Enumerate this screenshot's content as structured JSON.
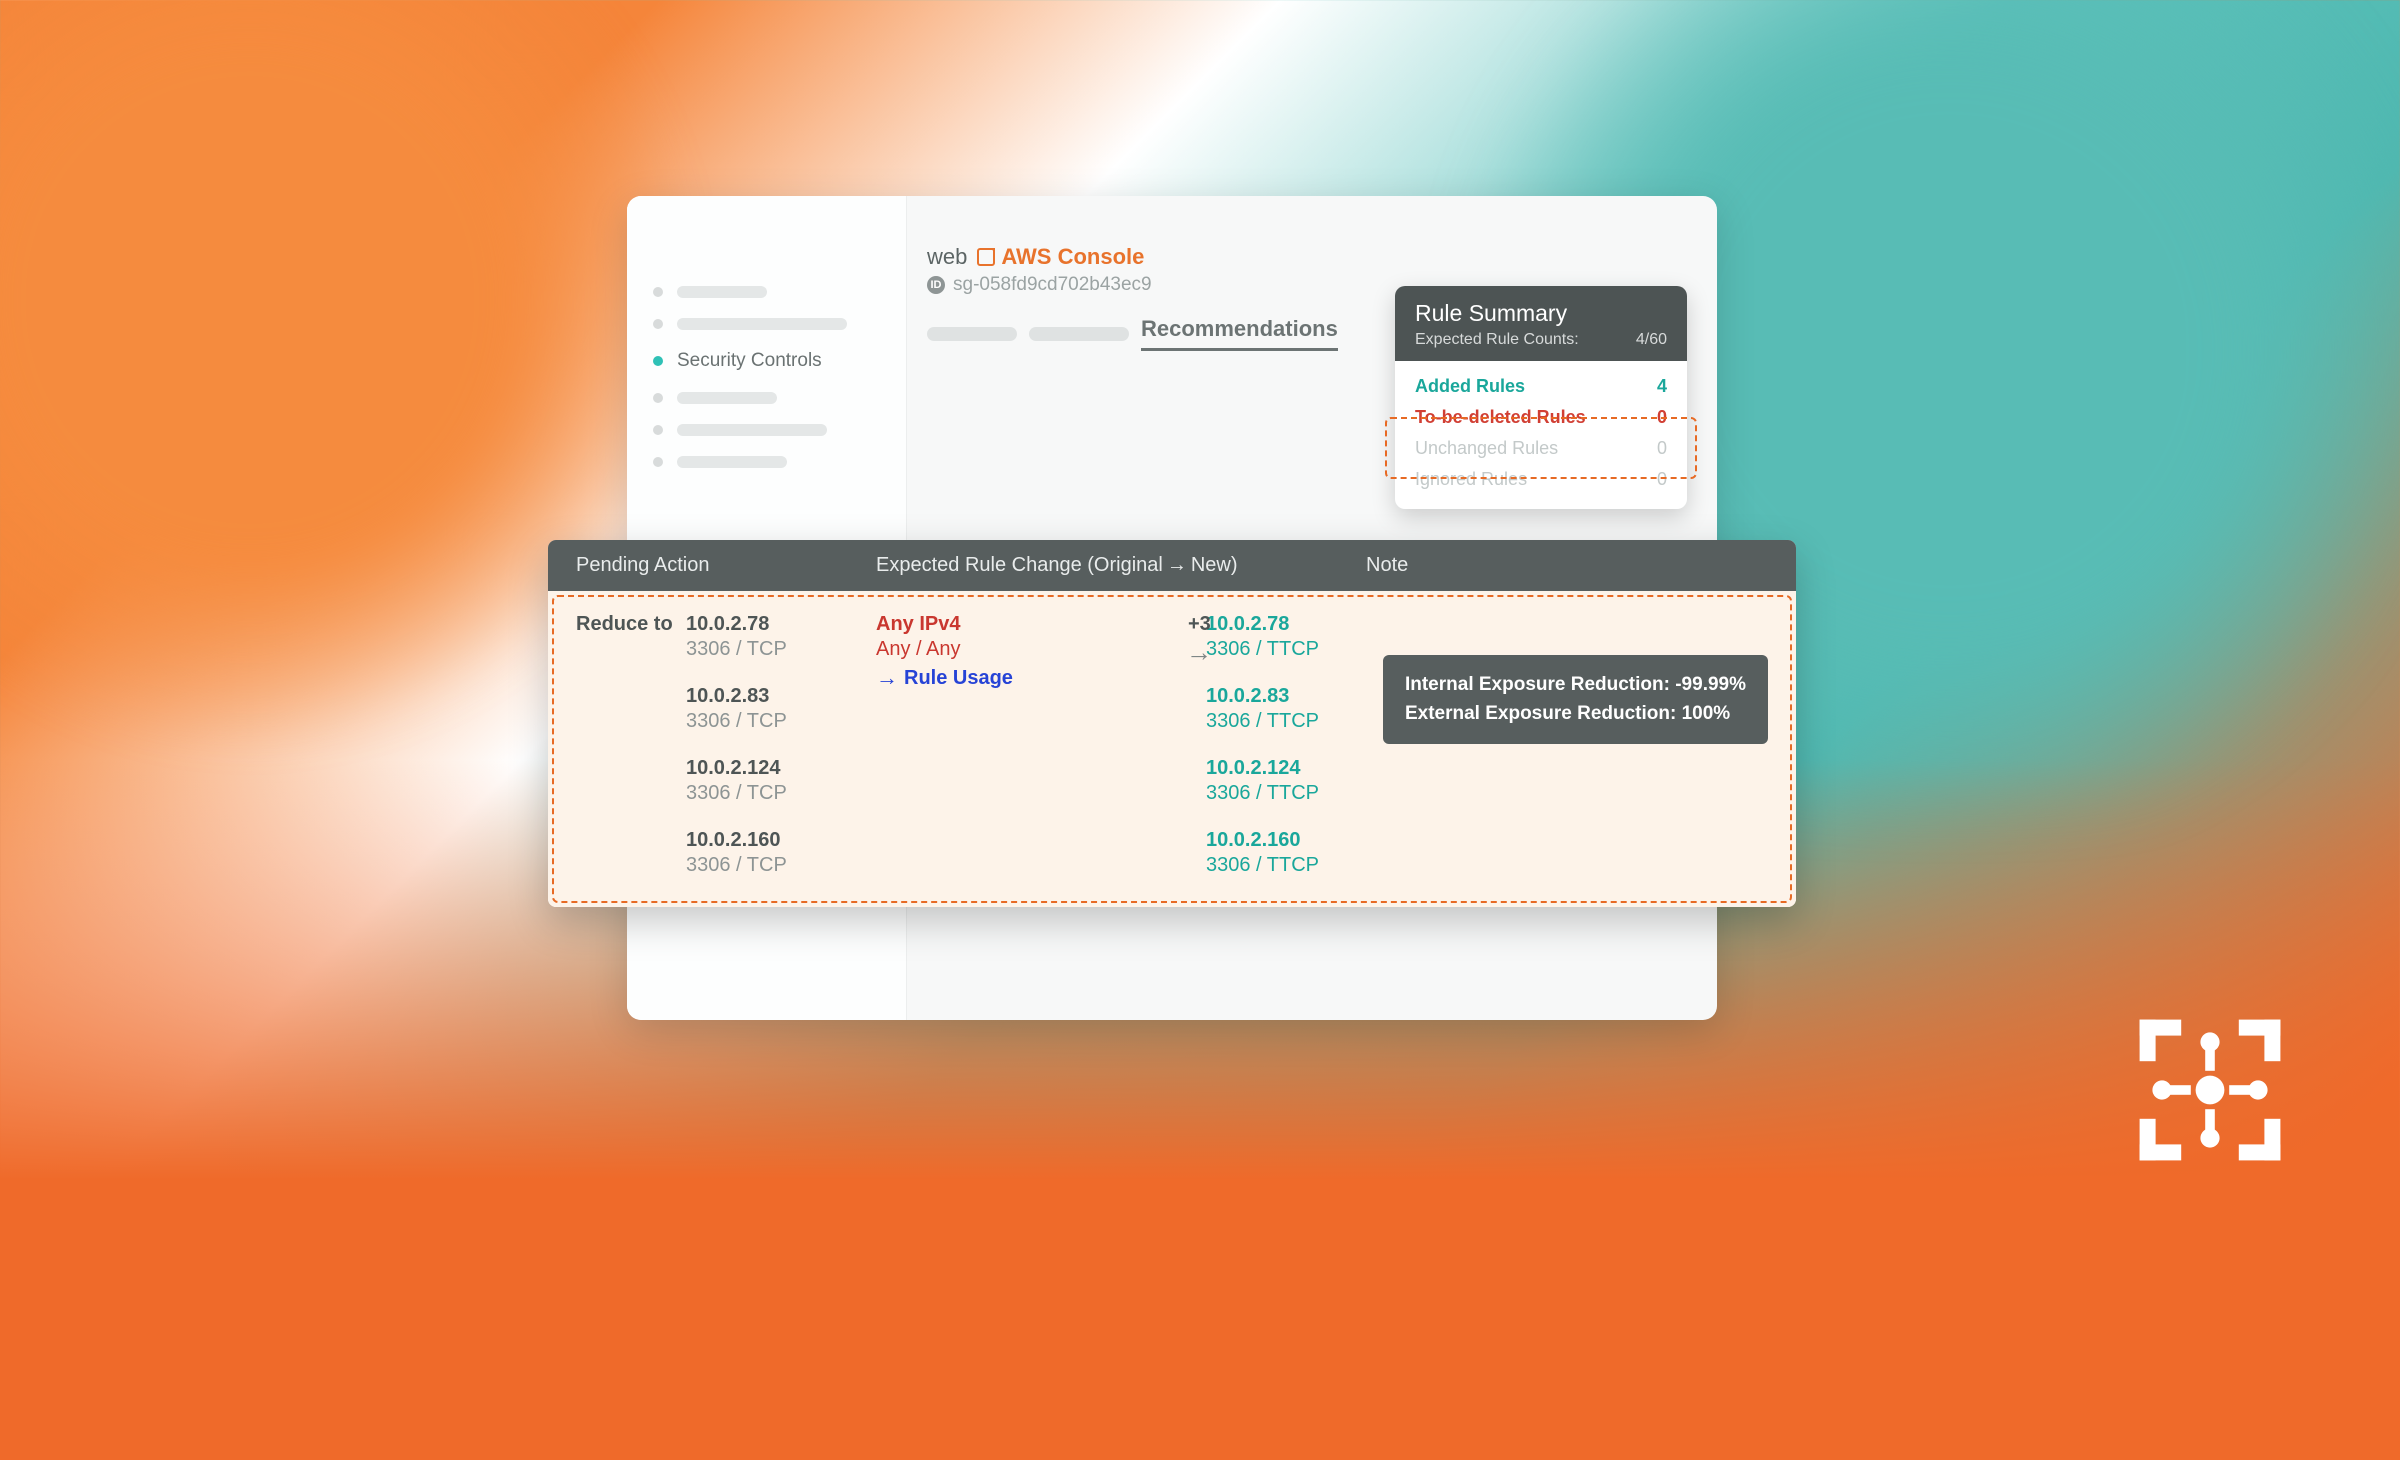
{
  "sidebar": {
    "active_label": "Security Controls"
  },
  "header": {
    "name": "web",
    "aws_link": "AWS Console",
    "id_label": "ID",
    "id_value": "sg-058fd9cd702b43ec9"
  },
  "tabs": {
    "active": "Recommendations"
  },
  "summary": {
    "title": "Rule Summary",
    "counts_label": "Expected Rule Counts:",
    "counts_value": "4/60",
    "added_label": "Added Rules",
    "added_value": "4",
    "deleted_label": "To-be-deleted Rules",
    "deleted_value": "0",
    "unchanged_label": "Unchanged Rules",
    "unchanged_value": "0",
    "ignored_label": "Ignored Rules",
    "ignored_value": "0"
  },
  "table": {
    "head_pending": "Pending Action",
    "head_change_a": "Expected Rule Change (Original",
    "head_change_b": "New)",
    "head_note": "Note",
    "pending_label": "Reduce to",
    "original": {
      "line1": "Any IPv4",
      "line2": "Any / Any",
      "usage": "Rule Usage"
    },
    "plus": "+3",
    "rows": [
      {
        "ip": "10.0.2.78",
        "proto": "3306 / TCP",
        "new_ip": "10.0.2.78",
        "new_proto": "3306 / TTCP"
      },
      {
        "ip": "10.0.2.83",
        "proto": "3306 / TCP",
        "new_ip": "10.0.2.83",
        "new_proto": "3306 / TTCP"
      },
      {
        "ip": "10.0.2.124",
        "proto": "3306 / TCP",
        "new_ip": "10.0.2.124",
        "new_proto": "3306 / TTCP"
      },
      {
        "ip": "10.0.2.160",
        "proto": "3306 / TCP",
        "new_ip": "10.0.2.160",
        "new_proto": "3306 / TTCP"
      }
    ],
    "note_line1": "Internal Exposure Reduction: -99.99%",
    "note_line2": "External Exposure Reduction: 100%"
  }
}
